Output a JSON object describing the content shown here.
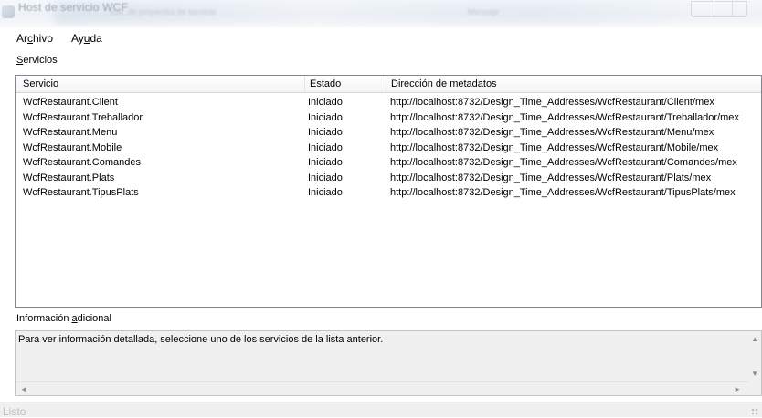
{
  "window": {
    "title": "Host de servicio WCF",
    "faded_caption_text": "sde, de proyectos de servicio",
    "faded_caption_right": "Mensaje"
  },
  "menu": {
    "items": [
      {
        "before": "Ar",
        "mnemonic": "c",
        "after": "hivo"
      },
      {
        "before": "Ay",
        "mnemonic": "u",
        "after": "da"
      }
    ]
  },
  "services_section": {
    "mnemonic": "S",
    "label_rest": "ervicios",
    "columns": [
      "Servicio",
      "Estado",
      "Dirección de metadatos"
    ],
    "rows": [
      {
        "service": "WcfRestaurant.Client",
        "state": "Iniciado",
        "address": "http://localhost:8732/Design_Time_Addresses/WcfRestaurant/Client/mex"
      },
      {
        "service": "WcfRestaurant.Treballador",
        "state": "Iniciado",
        "address": "http://localhost:8732/Design_Time_Addresses/WcfRestaurant/Treballador/mex"
      },
      {
        "service": "WcfRestaurant.Menu",
        "state": "Iniciado",
        "address": "http://localhost:8732/Design_Time_Addresses/WcfRestaurant/Menu/mex"
      },
      {
        "service": "WcfRestaurant.Mobile",
        "state": "Iniciado",
        "address": "http://localhost:8732/Design_Time_Addresses/WcfRestaurant/Mobile/mex"
      },
      {
        "service": "WcfRestaurant.Comandes",
        "state": "Iniciado",
        "address": "http://localhost:8732/Design_Time_Addresses/WcfRestaurant/Comandes/mex"
      },
      {
        "service": "WcfRestaurant.Plats",
        "state": "Iniciado",
        "address": "http://localhost:8732/Design_Time_Addresses/WcfRestaurant/Plats/mex"
      },
      {
        "service": "WcfRestaurant.TipusPlats",
        "state": "Iniciado",
        "address": "http://localhost:8732/Design_Time_Addresses/WcfRestaurant/TipusPlats/mex"
      }
    ]
  },
  "info_section": {
    "label_before": "Información ",
    "mnemonic": "a",
    "label_after": "dicional",
    "text": "Para ver información detallada, seleccione uno de los servicios de la lista anterior."
  },
  "status": {
    "text": "Listo"
  },
  "icons": {
    "app": "wcf-host-icon",
    "scroll_up": "▲",
    "scroll_down": "▼",
    "scroll_left": "◄",
    "scroll_right": "►"
  }
}
